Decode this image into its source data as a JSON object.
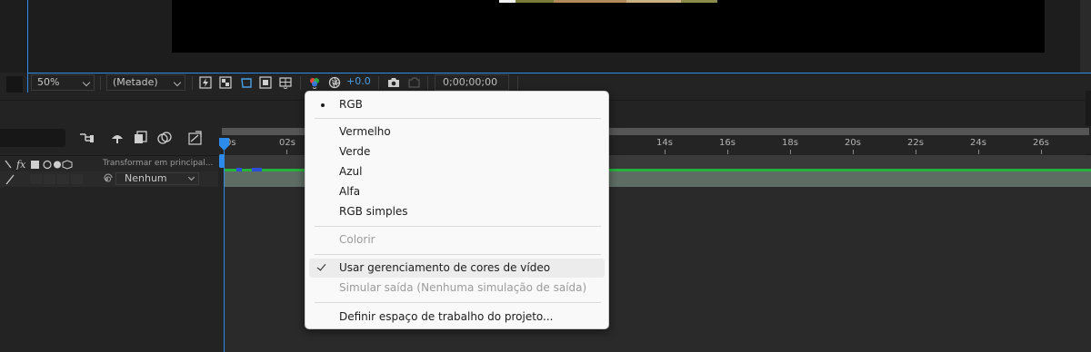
{
  "viewer_toolbar": {
    "zoom": "50%",
    "resolution": "(Metade)",
    "exposure": "+0.0",
    "timecode": "0;00;00;00"
  },
  "timeline": {
    "tick_labels": [
      "0s",
      "02s",
      "14s",
      "16s",
      "18s",
      "20s",
      "22s",
      "24s",
      "26s"
    ],
    "column_header_parent": "Transformar em principal...",
    "layer_parent": "Nenhum"
  },
  "menu": {
    "items": [
      {
        "label": "RGB",
        "selected": true
      },
      {
        "label": "Vermelho"
      },
      {
        "label": "Verde"
      },
      {
        "label": "Azul"
      },
      {
        "label": "Alfa"
      },
      {
        "label": "RGB simples"
      },
      {
        "label": "Colorir",
        "disabled": true
      },
      {
        "label": "Usar gerenciamento de cores de vídeo",
        "checked": true
      },
      {
        "label": "Simular saída (Nenhuma simulação de saída)",
        "disabled": true
      },
      {
        "label": "Definir espaço de trabalho do projeto..."
      }
    ]
  },
  "colors": {
    "accent": "#2d8ceb",
    "layer_green": "#27b23b",
    "menu_bg": "#f9f9f9"
  }
}
